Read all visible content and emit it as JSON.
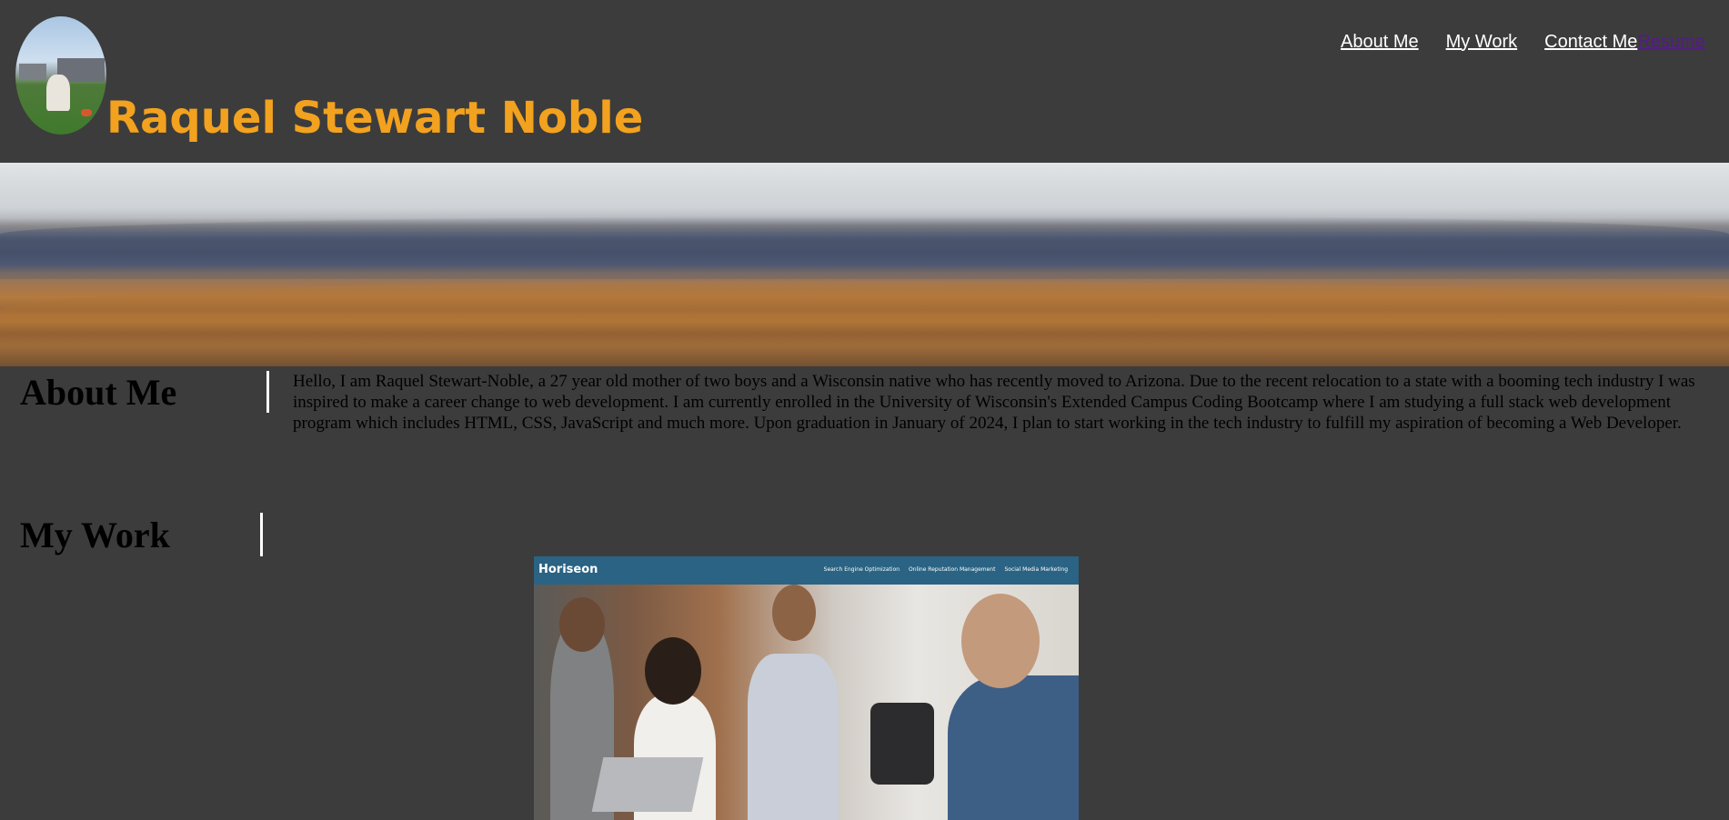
{
  "header": {
    "title": "Raquel Stewart Noble",
    "nav": [
      {
        "label": "About Me"
      },
      {
        "label": "My Work"
      },
      {
        "label": "Contact Me"
      },
      {
        "label": "Resume"
      }
    ]
  },
  "about": {
    "heading": "About Me",
    "text": "Hello, I am Raquel Stewart-Noble, a 27 year old mother of two boys and a Wisconsin native who has recently moved to Arizona. Due to the recent relocation to a state with a booming tech industry I was inspired to make a career change to web development. I am currently enrolled in the University of Wisconsin's Extended Campus Coding Bootcamp where I am studying a full stack web development program which includes HTML, CSS, JavaScript and much more. Upon graduation in January of 2024, I plan to start working in the tech industry to fulfill my aspiration of becoming a Web Developer."
  },
  "work": {
    "heading": "My Work",
    "project": {
      "brand": "Horiseon",
      "links": [
        "Search Engine Optimization",
        "Online Reputation Management",
        "Social Media Marketing"
      ]
    }
  },
  "colors": {
    "background": "#3c3c3c",
    "title": "#f2a21e",
    "nav_link": "#ffffff",
    "nav_visited": "#551a8b",
    "project_bar": "#2a6383"
  }
}
